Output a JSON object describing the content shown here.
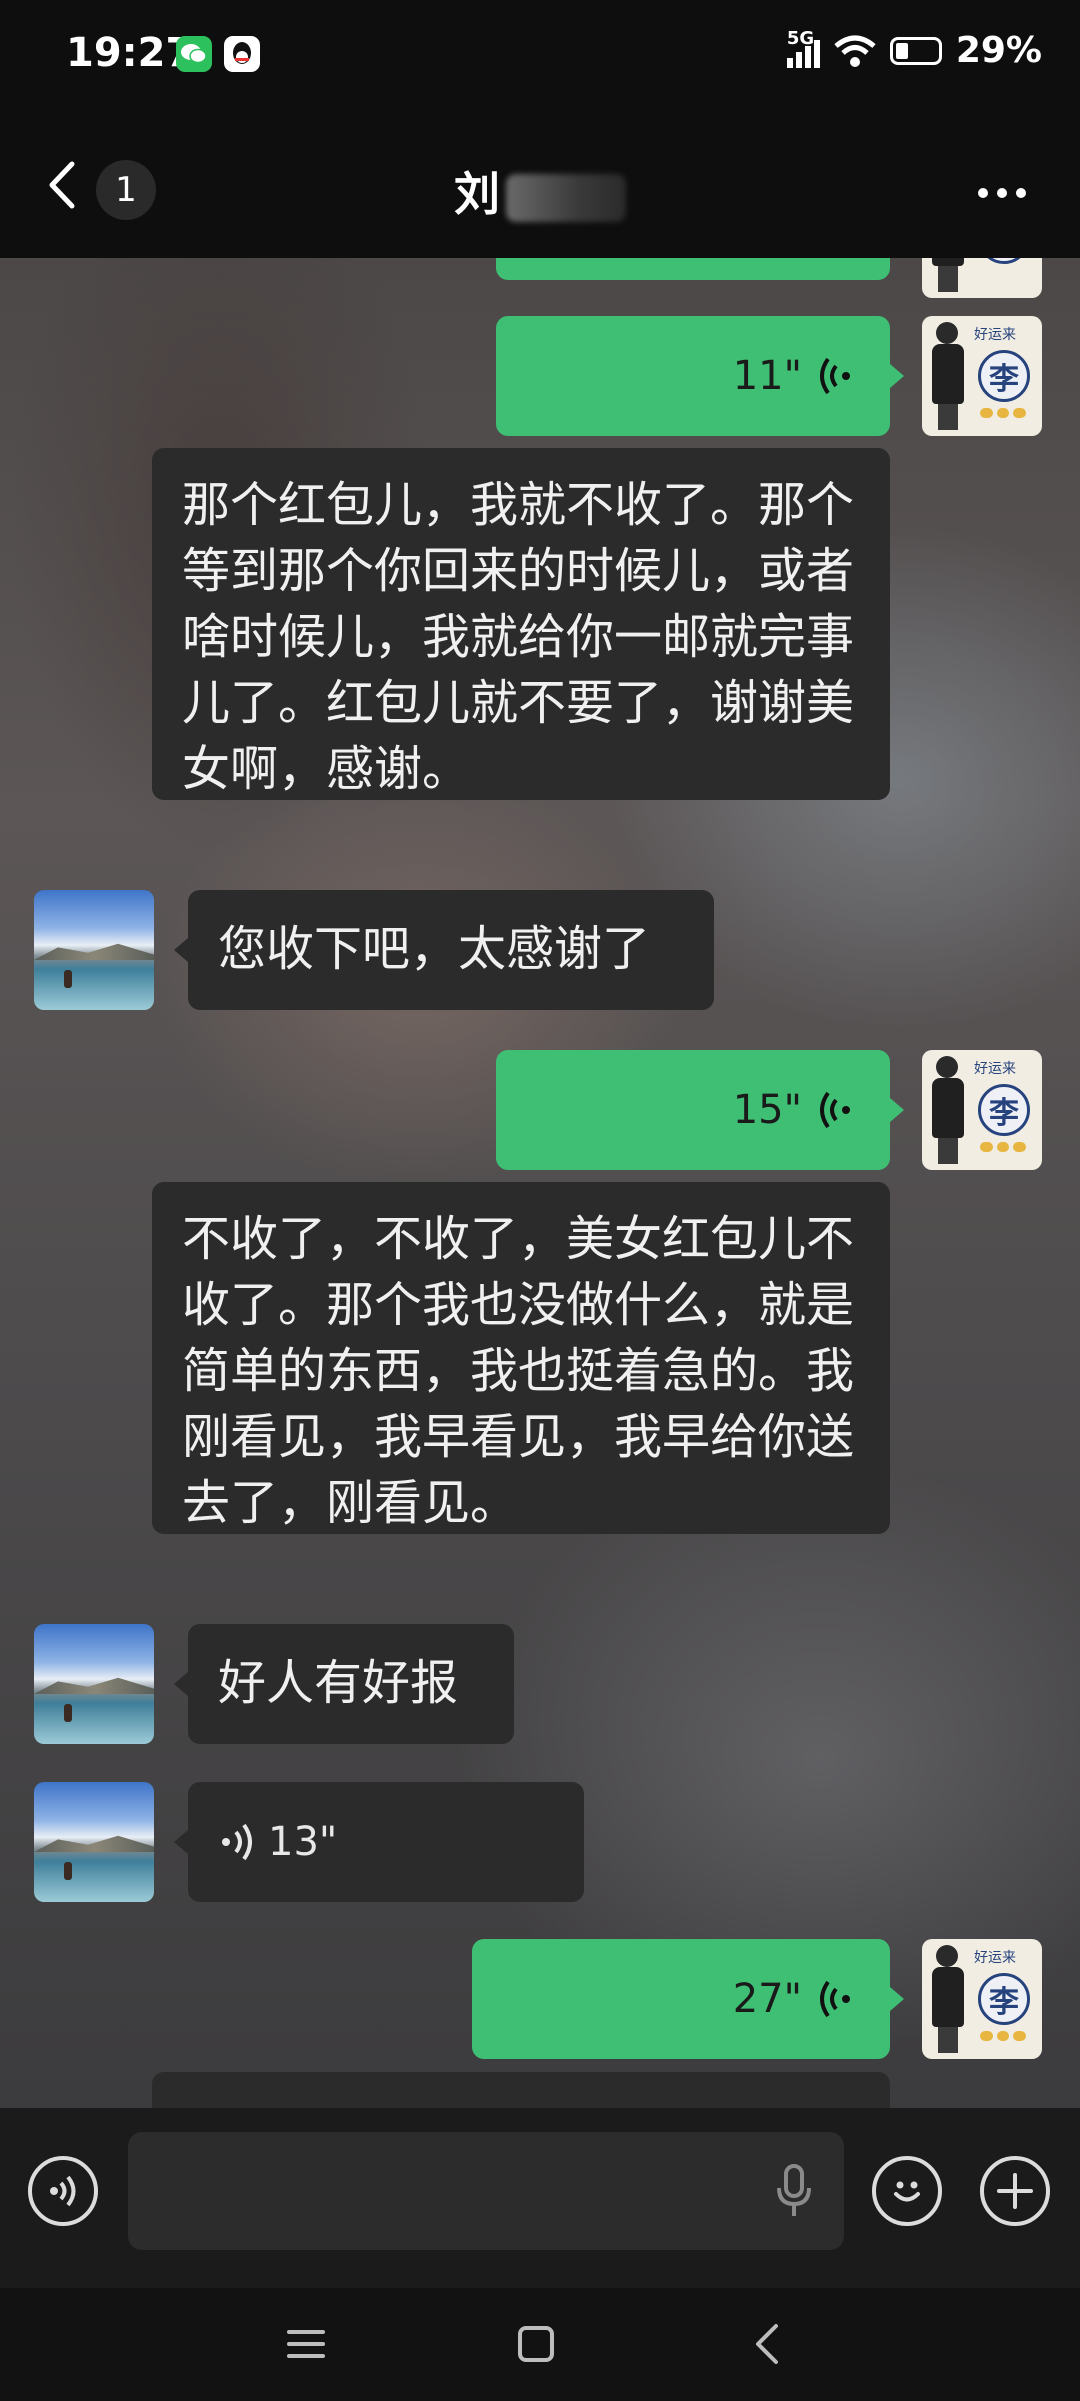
{
  "status": {
    "time": "19:27",
    "network": "5G",
    "battery": "29%"
  },
  "header": {
    "unread_count": "1",
    "title": "刘"
  },
  "messages": [
    {
      "dir": "out",
      "type": "voice",
      "duration": "11\""
    },
    {
      "dir": "in",
      "type": "text",
      "text": "那个红包儿，我就不收了。那个等到那个你回来的时候儿，或者啥时候儿，我就给你一邮就完事儿了。红包儿就不要了，谢谢美女啊，感谢。"
    },
    {
      "dir": "in",
      "type": "text",
      "text": "您收下吧，太感谢了"
    },
    {
      "dir": "out",
      "type": "voice",
      "duration": "15\""
    },
    {
      "dir": "in",
      "type": "text",
      "text": "不收了，不收了，美女红包儿不收了。那个我也没做什么，就是简单的东西，我也挺着急的。我刚看见，我早看见，我早给你送去了，刚看见。"
    },
    {
      "dir": "in",
      "type": "text",
      "text": "好人有好报"
    },
    {
      "dir": "in",
      "type": "voice",
      "duration": "13\""
    },
    {
      "dir": "out",
      "type": "voice",
      "duration": "27\""
    }
  ],
  "avatar": {
    "brand_char": "李"
  },
  "icons": [
    "back-icon",
    "more-icon",
    "voice-icon",
    "mic-icon",
    "emoji-icon",
    "plus-icon",
    "menu-icon",
    "home-icon",
    "nav-back-icon"
  ],
  "colors": {
    "sent_bubble": "#3fbf74",
    "received_bubble": "#2b2b2b",
    "background": "#0e0e0e"
  }
}
